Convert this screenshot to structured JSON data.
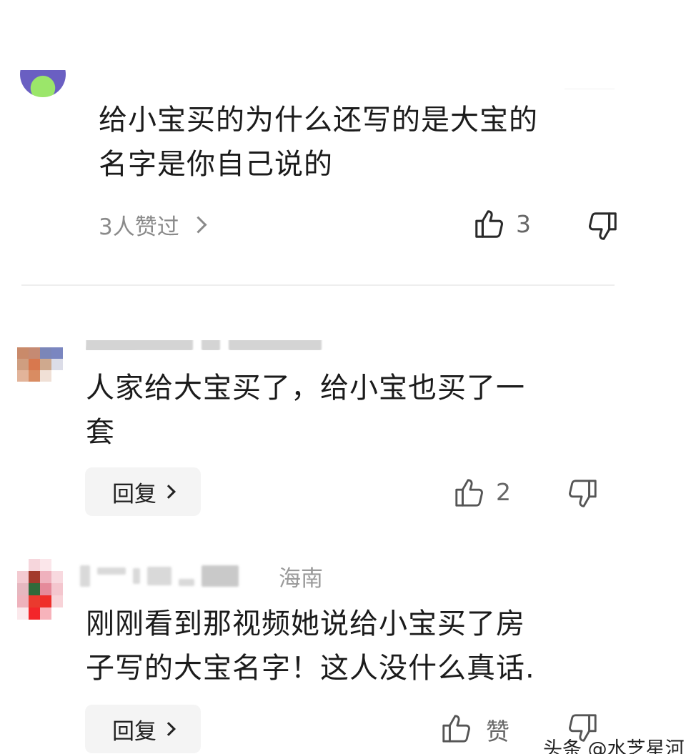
{
  "comments": [
    {
      "text": "给小宝买的为什么还写的是大宝的\n名字是你自己说的",
      "likes_summary": "3人赞过",
      "like_count": "3"
    },
    {
      "text": "人家给大宝买了，给小宝也买了一\n套",
      "reply_label": "回复",
      "like_count": "2"
    },
    {
      "location": "海南",
      "text": "刚刚看到那视频她说给小宝买了房\n子写的大宝名字！这人没什么真话.",
      "reply_label": "回复",
      "like_label": "赞"
    }
  ],
  "watermark": "头条 @水芝星河",
  "icons": {
    "like": "thumbs-up-icon",
    "dislike": "thumbs-down-icon",
    "chevron": "chevron-right-icon"
  },
  "colors": {
    "text_primary": "#1b1b1b",
    "text_secondary": "#8a8a8a",
    "reply_bg": "#f4f4f4"
  }
}
